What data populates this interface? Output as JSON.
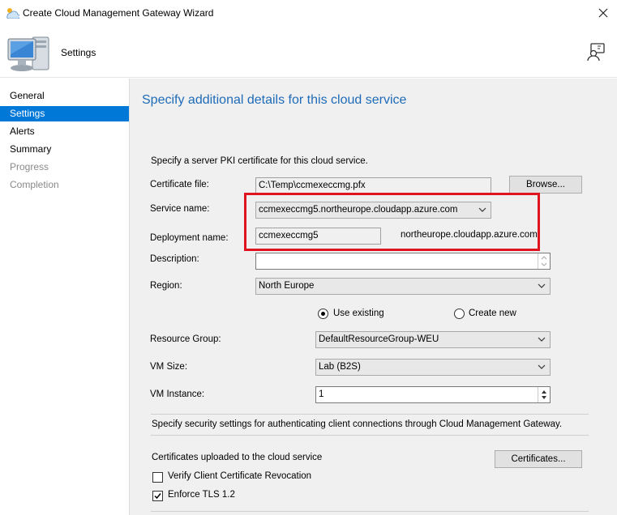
{
  "window": {
    "title": "Create Cloud Management Gateway Wizard"
  },
  "header": {
    "step_title": "Settings"
  },
  "nav": {
    "items": [
      {
        "label": "General",
        "state": "normal"
      },
      {
        "label": "Settings",
        "state": "selected"
      },
      {
        "label": "Alerts",
        "state": "normal"
      },
      {
        "label": "Summary",
        "state": "normal"
      },
      {
        "label": "Progress",
        "state": "disabled"
      },
      {
        "label": "Completion",
        "state": "disabled"
      }
    ]
  },
  "main": {
    "heading": "Specify additional details for this cloud service",
    "pki_intro": "Specify a server PKI certificate for this cloud service.",
    "certificate_file": {
      "label": "Certificate file:",
      "value": "C:\\Temp\\ccmexeccmg.pfx",
      "browse_label": "Browse..."
    },
    "service_name": {
      "label": "Service name:",
      "value": "ccmexeccmg5.northeurope.cloudapp.azure.com"
    },
    "deployment_name": {
      "label": "Deployment name:",
      "value": "ccmexeccmg5",
      "suffix": "northeurope.cloudapp.azure.com"
    },
    "description": {
      "label": "Description:",
      "value": ""
    },
    "region": {
      "label": "Region:",
      "value": "North Europe"
    },
    "resource_options": {
      "use_existing": "Use existing",
      "create_new": "Create new",
      "selected": "use_existing"
    },
    "resource_group": {
      "label": "Resource Group:",
      "value": "DefaultResourceGroup-WEU"
    },
    "vm_size": {
      "label": "VM Size:",
      "value": "Lab (B2S)"
    },
    "vm_instance": {
      "label": "VM Instance:",
      "value": "1"
    },
    "security_intro": "Specify security settings for authenticating client connections through Cloud Management Gateway.",
    "certs_uploaded": {
      "label": "Certificates uploaded to the cloud service",
      "button": "Certificates..."
    },
    "verify_revocation": {
      "label": "Verify Client Certificate Revocation",
      "checked": false
    },
    "enforce_tls": {
      "label": "Enforce TLS 1.2",
      "checked": true
    }
  },
  "colors": {
    "accent": "#0078d7",
    "heading": "#1e6bb8",
    "highlight": "#e0141e"
  }
}
